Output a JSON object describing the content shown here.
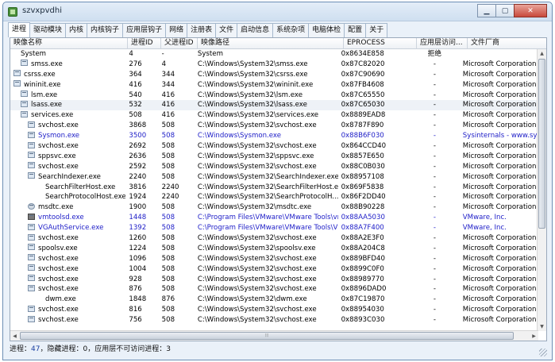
{
  "window": {
    "title": "szvxpvdhi"
  },
  "tabs": [
    "进程",
    "驱动模块",
    "内核",
    "内核钩子",
    "应用层钩子",
    "网络",
    "注册表",
    "文件",
    "启动信息",
    "系统杂项",
    "电脑体检",
    "配置",
    "关于"
  ],
  "columns": [
    "映像名称",
    "进程ID",
    "父进程ID",
    "映像路径",
    "EPROCESS",
    "应用层访问...",
    "文件厂商"
  ],
  "rows": [
    {
      "name": "System",
      "pid": "4",
      "ppid": "-",
      "path": "System",
      "eprocess": "0x8634E858",
      "access": "拒绝",
      "vendor": "",
      "indent": 0,
      "icon": "none",
      "style": ""
    },
    {
      "name": "smss.exe",
      "pid": "276",
      "ppid": "4",
      "path": "C:\\Windows\\System32\\smss.exe",
      "eprocess": "0x87C82020",
      "access": "-",
      "vendor": "Microsoft Corporation",
      "indent": 1,
      "icon": "win",
      "style": ""
    },
    {
      "name": "csrss.exe",
      "pid": "364",
      "ppid": "344",
      "path": "C:\\Windows\\System32\\csrss.exe",
      "eprocess": "0x87C90690",
      "access": "-",
      "vendor": "Microsoft Corporation",
      "indent": 0,
      "icon": "win",
      "style": ""
    },
    {
      "name": "wininit.exe",
      "pid": "416",
      "ppid": "344",
      "path": "C:\\Windows\\System32\\wininit.exe",
      "eprocess": "0x87FB4608",
      "access": "-",
      "vendor": "Microsoft Corporation",
      "indent": 0,
      "icon": "win",
      "style": ""
    },
    {
      "name": "lsm.exe",
      "pid": "540",
      "ppid": "416",
      "path": "C:\\Windows\\System32\\lsm.exe",
      "eprocess": "0x87C65550",
      "access": "-",
      "vendor": "Microsoft Corporation",
      "indent": 1,
      "icon": "win",
      "style": ""
    },
    {
      "name": "lsass.exe",
      "pid": "532",
      "ppid": "416",
      "path": "C:\\Windows\\System32\\lsass.exe",
      "eprocess": "0x87C65030",
      "access": "-",
      "vendor": "Microsoft Corporation",
      "indent": 1,
      "icon": "win",
      "style": "hl"
    },
    {
      "name": "services.exe",
      "pid": "508",
      "ppid": "416",
      "path": "C:\\Windows\\System32\\services.exe",
      "eprocess": "0x8889EAD8",
      "access": "-",
      "vendor": "Microsoft Corporation",
      "indent": 1,
      "icon": "win",
      "style": ""
    },
    {
      "name": "svchost.exe",
      "pid": "3868",
      "ppid": "508",
      "path": "C:\\Windows\\System32\\svchost.exe",
      "eprocess": "0x8787F890",
      "access": "-",
      "vendor": "Microsoft Corporation",
      "indent": 2,
      "icon": "win",
      "style": ""
    },
    {
      "name": "Sysmon.exe",
      "pid": "3500",
      "ppid": "508",
      "path": "C:\\Windows\\Sysmon.exe",
      "eprocess": "0x88B6F030",
      "access": "-",
      "vendor": "Sysinternals - www.sysinte...",
      "indent": 2,
      "icon": "win",
      "style": "blue"
    },
    {
      "name": "svchost.exe",
      "pid": "2692",
      "ppid": "508",
      "path": "C:\\Windows\\System32\\svchost.exe",
      "eprocess": "0x864CCD40",
      "access": "-",
      "vendor": "Microsoft Corporation",
      "indent": 2,
      "icon": "win",
      "style": ""
    },
    {
      "name": "sppsvc.exe",
      "pid": "2636",
      "ppid": "508",
      "path": "C:\\Windows\\System32\\sppsvc.exe",
      "eprocess": "0x8857E650",
      "access": "-",
      "vendor": "Microsoft Corporation",
      "indent": 2,
      "icon": "win",
      "style": ""
    },
    {
      "name": "svchost.exe",
      "pid": "2592",
      "ppid": "508",
      "path": "C:\\Windows\\System32\\svchost.exe",
      "eprocess": "0x88C0B030",
      "access": "-",
      "vendor": "Microsoft Corporation",
      "indent": 2,
      "icon": "win",
      "style": ""
    },
    {
      "name": "SearchIndexer.exe",
      "pid": "2240",
      "ppid": "508",
      "path": "C:\\Windows\\System32\\SearchIndexer.exe",
      "eprocess": "0x88957108",
      "access": "-",
      "vendor": "Microsoft Corporation",
      "indent": 2,
      "icon": "win",
      "style": ""
    },
    {
      "name": "SearchFilterHost.exe",
      "pid": "3816",
      "ppid": "2240",
      "path": "C:\\Windows\\System32\\SearchFilterHost.exe",
      "eprocess": "0x869F5838",
      "access": "-",
      "vendor": "Microsoft Corporation",
      "indent": 3,
      "icon": "none",
      "style": ""
    },
    {
      "name": "SearchProtocolHost.exe",
      "pid": "1924",
      "ppid": "2240",
      "path": "C:\\Windows\\System32\\SearchProtocolH...",
      "eprocess": "0x86F2DD40",
      "access": "-",
      "vendor": "Microsoft Corporation",
      "indent": 3,
      "icon": "none",
      "style": ""
    },
    {
      "name": "msdtc.exe",
      "pid": "1900",
      "ppid": "508",
      "path": "C:\\Windows\\System32\\msdtc.exe",
      "eprocess": "0x88B90228",
      "access": "-",
      "vendor": "Microsoft Corporation",
      "indent": 2,
      "icon": "gear",
      "style": ""
    },
    {
      "name": "vmtoolsd.exe",
      "pid": "1448",
      "ppid": "508",
      "path": "C:\\Program Files\\VMware\\VMware Tools\\vmt...",
      "eprocess": "0x88AA5030",
      "access": "-",
      "vendor": "VMware, Inc.",
      "indent": 2,
      "icon": "vm",
      "style": "blue"
    },
    {
      "name": "VGAuthService.exe",
      "pid": "1392",
      "ppid": "508",
      "path": "C:\\Program Files\\VMware\\VMware Tools\\VM...",
      "eprocess": "0x88A7F400",
      "access": "-",
      "vendor": "VMware, Inc.",
      "indent": 2,
      "icon": "win",
      "style": "blue"
    },
    {
      "name": "svchost.exe",
      "pid": "1260",
      "ppid": "508",
      "path": "C:\\Windows\\System32\\svchost.exe",
      "eprocess": "0x88A2E3F0",
      "access": "-",
      "vendor": "Microsoft Corporation",
      "indent": 2,
      "icon": "win",
      "style": ""
    },
    {
      "name": "spoolsv.exe",
      "pid": "1224",
      "ppid": "508",
      "path": "C:\\Windows\\System32\\spoolsv.exe",
      "eprocess": "0x88A204C8",
      "access": "-",
      "vendor": "Microsoft Corporation",
      "indent": 2,
      "icon": "win",
      "style": ""
    },
    {
      "name": "svchost.exe",
      "pid": "1096",
      "ppid": "508",
      "path": "C:\\Windows\\System32\\svchost.exe",
      "eprocess": "0x889BFD40",
      "access": "-",
      "vendor": "Microsoft Corporation",
      "indent": 2,
      "icon": "win",
      "style": ""
    },
    {
      "name": "svchost.exe",
      "pid": "1004",
      "ppid": "508",
      "path": "C:\\Windows\\System32\\svchost.exe",
      "eprocess": "0x8899C0F0",
      "access": "-",
      "vendor": "Microsoft Corporation",
      "indent": 2,
      "icon": "win",
      "style": ""
    },
    {
      "name": "svchost.exe",
      "pid": "928",
      "ppid": "508",
      "path": "C:\\Windows\\System32\\svchost.exe",
      "eprocess": "0x88989770",
      "access": "-",
      "vendor": "Microsoft Corporation",
      "indent": 2,
      "icon": "win",
      "style": ""
    },
    {
      "name": "svchost.exe",
      "pid": "876",
      "ppid": "508",
      "path": "C:\\Windows\\System32\\svchost.exe",
      "eprocess": "0x8896DAD0",
      "access": "-",
      "vendor": "Microsoft Corporation",
      "indent": 2,
      "icon": "win",
      "style": ""
    },
    {
      "name": "dwm.exe",
      "pid": "1848",
      "ppid": "876",
      "path": "C:\\Windows\\System32\\dwm.exe",
      "eprocess": "0x87C19870",
      "access": "-",
      "vendor": "Microsoft Corporation",
      "indent": 3,
      "icon": "none",
      "style": ""
    },
    {
      "name": "svchost.exe",
      "pid": "816",
      "ppid": "508",
      "path": "C:\\Windows\\System32\\svchost.exe",
      "eprocess": "0x88954030",
      "access": "-",
      "vendor": "Microsoft Corporation",
      "indent": 2,
      "icon": "win",
      "style": ""
    },
    {
      "name": "svchost.exe",
      "pid": "756",
      "ppid": "508",
      "path": "C:\\Windows\\System32\\svchost.exe",
      "eprocess": "0x8893C030",
      "access": "-",
      "vendor": "Microsoft Corporation",
      "indent": 2,
      "icon": "win",
      "style": ""
    }
  ],
  "status": {
    "process_label": "进程：",
    "process_count": "47",
    "hidden_label": "，隐藏进程：",
    "hidden_count": "0",
    "inaccessible_label": "，应用层不可访问进程：",
    "inaccessible_count": "3"
  },
  "icons": {
    "app": "app-icon",
    "minimize": "minimize-icon",
    "maximize": "maximize-icon",
    "close": "close-icon"
  }
}
